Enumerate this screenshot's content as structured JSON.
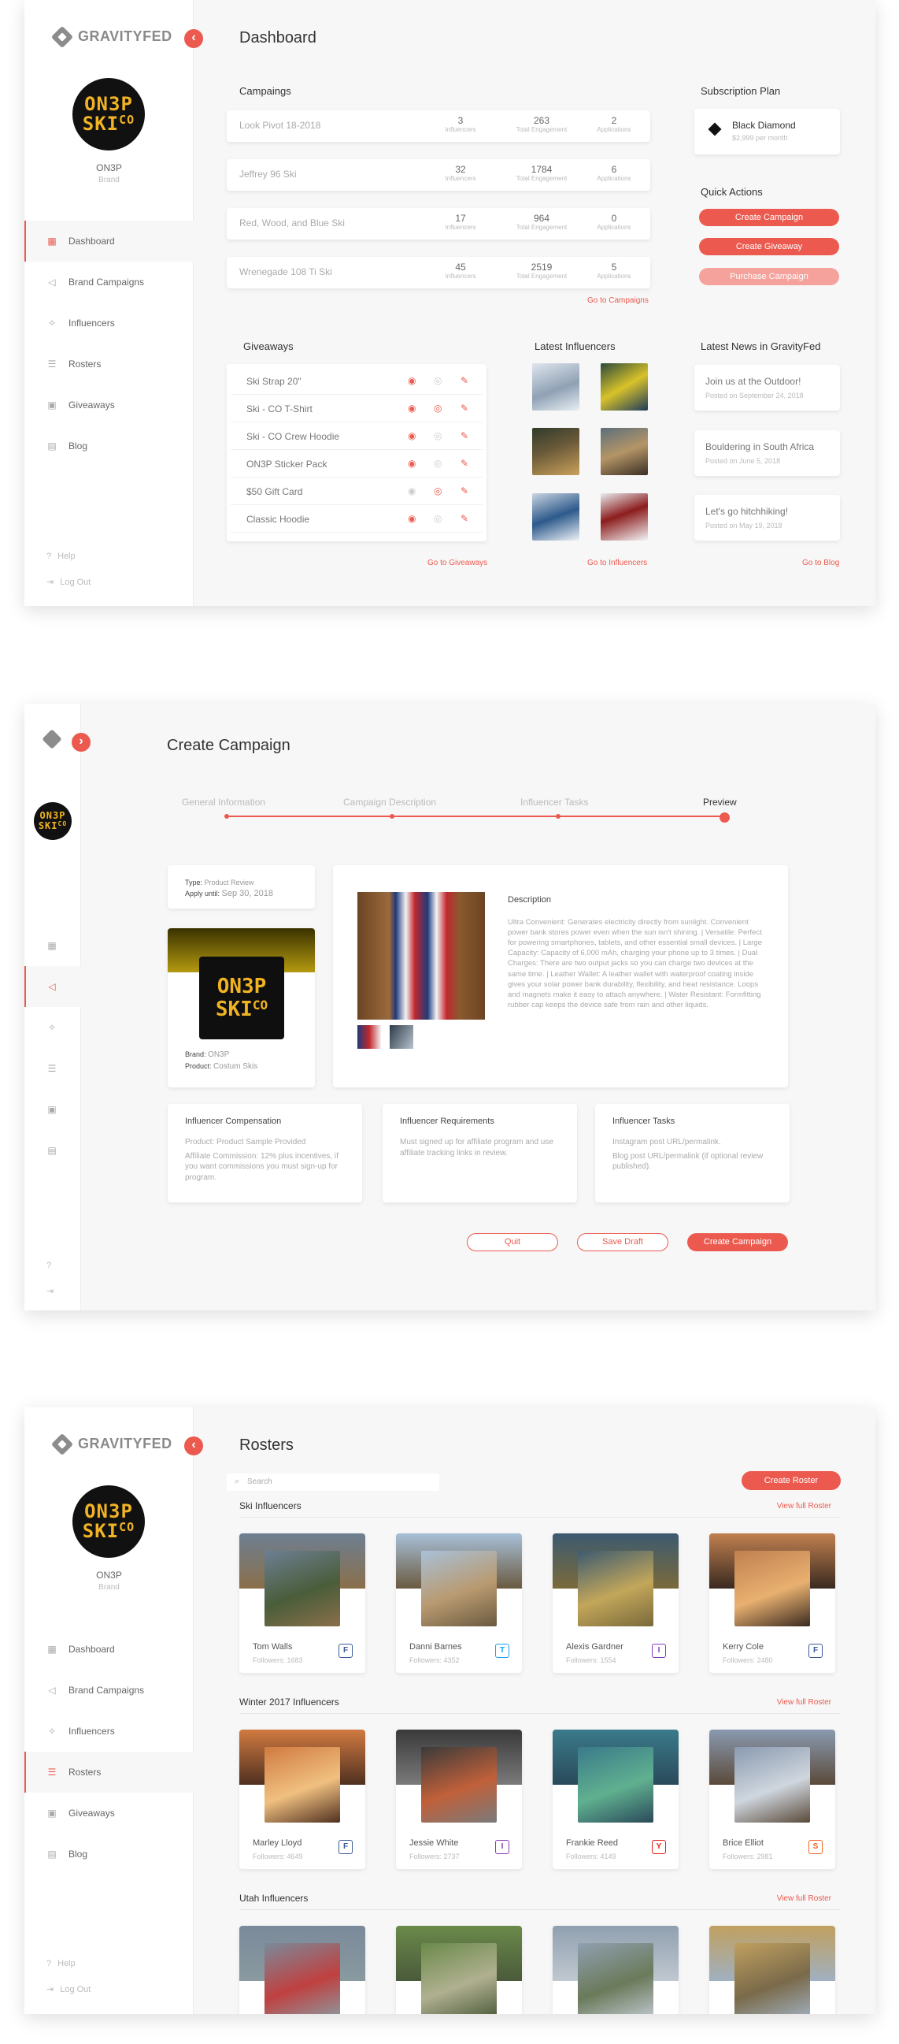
{
  "app": {
    "logo_text": "GRAVITYFED"
  },
  "brand": {
    "logo_line1": "ON3P",
    "logo_line2": "SKI",
    "logo_line2b": "CO",
    "name": "ON3P",
    "sub": "Brand"
  },
  "nav": [
    {
      "label": "Dashboard",
      "icon": "dashboard-icon"
    },
    {
      "label": "Brand Campaigns",
      "icon": "megaphone-icon"
    },
    {
      "label": "Influencers",
      "icon": "runner-icon"
    },
    {
      "label": "Rosters",
      "icon": "roster-icon"
    },
    {
      "label": "Giveaways",
      "icon": "gift-icon"
    },
    {
      "label": "Blog",
      "icon": "blog-icon"
    }
  ],
  "footer": {
    "help": "Help",
    "logout": "Log Out"
  },
  "dashboard": {
    "title": "Dashboard",
    "campaigns_title": "Campaings",
    "campaigns": [
      {
        "name": "Look Pivot 18-2018",
        "influencers": "3",
        "engagement": "263",
        "applications": "2"
      },
      {
        "name": "Jeffrey 96 Ski",
        "influencers": "32",
        "engagement": "1784",
        "applications": "6"
      },
      {
        "name": "Red, Wood, and Blue Ski",
        "influencers": "17",
        "engagement": "964",
        "applications": "0"
      },
      {
        "name": "Wrenegade 108 Ti Ski",
        "influencers": "45",
        "engagement": "2519",
        "applications": "5"
      }
    ],
    "stat_labels": {
      "influencers": "Influencers",
      "engagement": "Total Engagement",
      "applications": "Applications"
    },
    "go_campaigns": "Go to Campaigns",
    "subscription_title": "Subscription Plan",
    "plan_name": "Black Diamond",
    "plan_price": "$2,999 per month",
    "quick_actions_title": "Quick Actions",
    "quick_actions": [
      "Create Campaign",
      "Create Giveaway",
      "Purchase Campaign"
    ],
    "giveaways_title": "Giveaways",
    "giveaways": [
      "Ski Strap 20\"",
      "Ski - CO T-Shirt",
      "Ski - CO Crew Hoodie",
      "ON3P Sticker Pack",
      "$50 Gift Card",
      "Classic Hoodie"
    ],
    "go_giveaways": "Go to Giveaways",
    "influencers_title": "Latest Influencers",
    "go_influencers": "Go to Influencers",
    "news_title": "Latest News in GravityFed",
    "news": [
      {
        "title": "Join us at the Outdoor!",
        "date": "Posted on September 24, 2018"
      },
      {
        "title": "Bouldering in South Africa",
        "date": "Posted on June 5, 2018"
      },
      {
        "title": "Let's go hitchhiking!",
        "date": "Posted on May 19, 2018"
      }
    ],
    "go_blog": "Go to Blog"
  },
  "create": {
    "title": "Create Campaign",
    "steps": [
      "General Information",
      "Campaign Description",
      "Influencer Tasks",
      "Preview"
    ],
    "type_label": "Type:",
    "type_value": "Product Review",
    "apply_label": "Apply until:",
    "apply_value": "Sep 30, 2018",
    "brand_label": "Brand:",
    "brand_value": "ON3P",
    "product_label": "Product:",
    "product_value": "Costum Skis",
    "desc_title": "Description",
    "desc_text": "Ultra Convenient: Generates electricity directly from sunlight. Convenient power bank stores power even when the sun isn't shining. | Versatile: Perfect for powering smartphones, tablets, and other essential small devices. | Large Capacity: Capacity of 6,000 mAh, charging your phone up to 3 times. | Dual Charges: There are two output jacks so you can charge two devices at the same time. | Leather Wallet: A leather wallet with waterproof coating inside gives your solar power bank durability, flexibility, and heat resistance. Loops and magnets make it easy to attach anywhere. | Water Resistant: Formfitting rubber cap keeps the device safe from rain and other liquids.",
    "comp_title": "Influencer Compensation",
    "comp_text1": "Product: Product Sample Provided",
    "comp_text2": "Affiliate Commission: 12% plus incentives, if you want commissions you must sign-up for program.",
    "req_title": "Influencer Requirements",
    "req_text": "Must signed up for affiliate program and use affiliate tracking links in review.",
    "tasks_title": "Influencer Tasks",
    "tasks_text1": "Instagram post URL/permalink.",
    "tasks_text2": "Blog post URL/permalink (if optional review published).",
    "buttons": {
      "quit": "Quit",
      "draft": "Save Draft",
      "create": "Create Campaign"
    }
  },
  "rosters": {
    "title": "Rosters",
    "search_placeholder": "Search",
    "create_button": "Create Roster",
    "view_full": "View full Roster",
    "groups": [
      {
        "name": "Ski Influencers",
        "members": [
          {
            "name": "Tom Walls",
            "followers": "Followers: 1683",
            "social": "F"
          },
          {
            "name": "Danni Barnes",
            "followers": "Followers: 4352",
            "social": "T"
          },
          {
            "name": "Alexis Gardner",
            "followers": "Followers: 1554",
            "social": "I"
          },
          {
            "name": "Kerry Cole",
            "followers": "Followers: 2480",
            "social": "F"
          }
        ]
      },
      {
        "name": "Winter 2017 Influencers",
        "members": [
          {
            "name": "Marley Lloyd",
            "followers": "Followers: 4649",
            "social": "F"
          },
          {
            "name": "Jessie White",
            "followers": "Followers: 2737",
            "social": "I"
          },
          {
            "name": "Frankie Reed",
            "followers": "Followers: 4149",
            "social": "Y"
          },
          {
            "name": "Brice Elliot",
            "followers": "Followers: 2981",
            "social": "S"
          }
        ]
      },
      {
        "name": "Utah Influencers",
        "members": [
          {
            "name": "",
            "followers": "",
            "social": ""
          },
          {
            "name": "",
            "followers": "",
            "social": ""
          },
          {
            "name": "",
            "followers": "",
            "social": ""
          },
          {
            "name": "",
            "followers": "",
            "social": ""
          }
        ]
      }
    ]
  },
  "colors": {
    "accent": "#ec5a4f",
    "accent_light": "#f4a29b",
    "brand_yellow": "#f0b323"
  }
}
